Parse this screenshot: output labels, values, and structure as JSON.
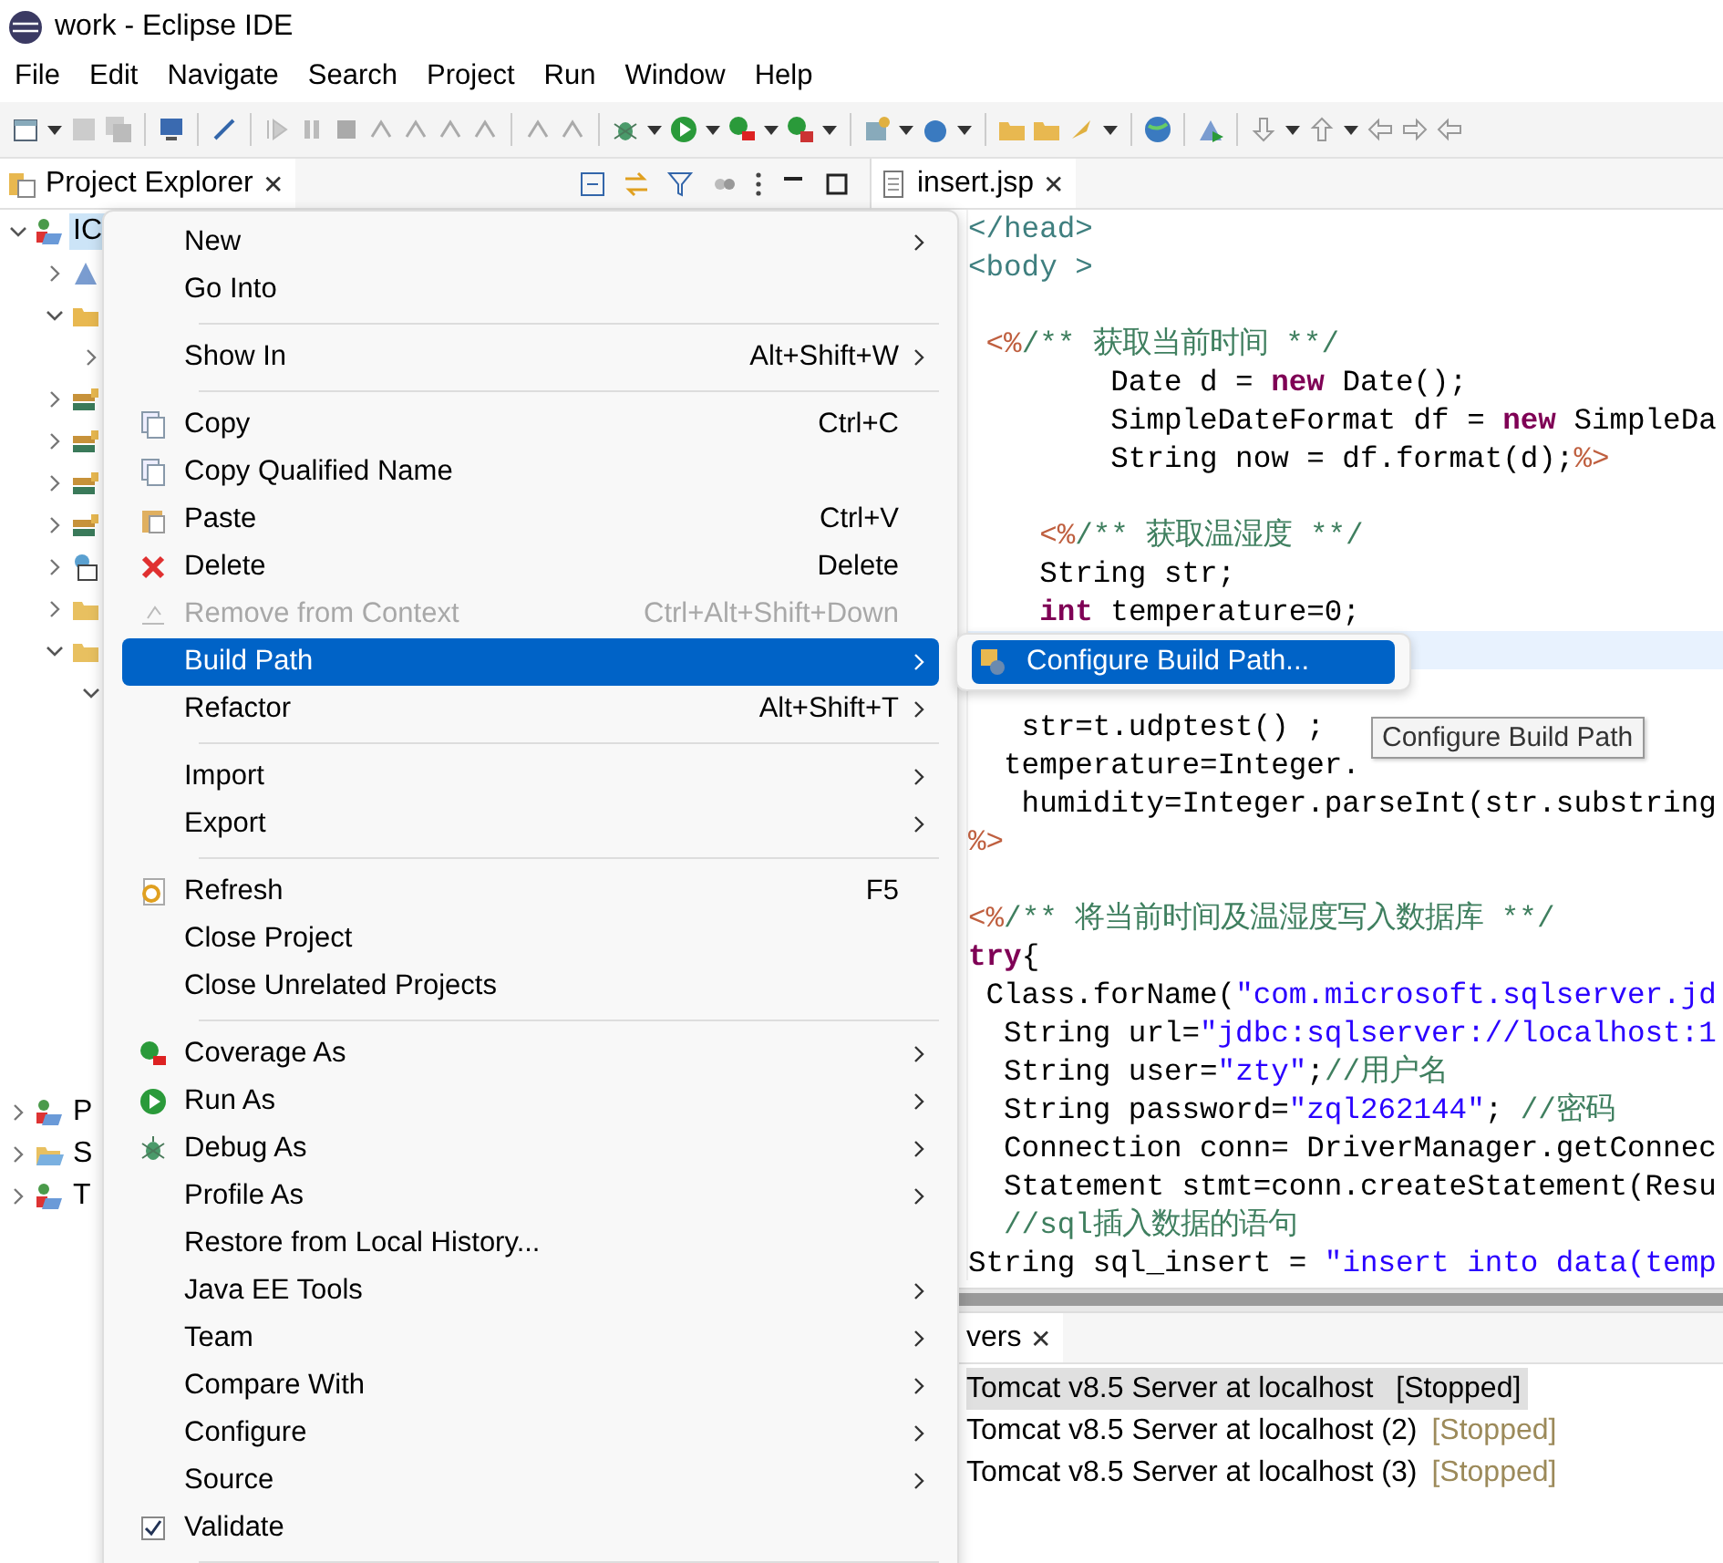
{
  "window": {
    "title": "work - Eclipse IDE"
  },
  "menubar": [
    "File",
    "Edit",
    "Navigate",
    "Search",
    "Project",
    "Run",
    "Window",
    "Help"
  ],
  "project_explorer": {
    "tab": {
      "label": "Project Explorer",
      "close": "✕"
    },
    "tree": [
      {
        "label": "IC",
        "kind": "project",
        "expanded": true,
        "selected": true,
        "children": [
          {
            "kind": "server",
            "expanded": false,
            "selected": false
          },
          {
            "kind": "package",
            "expanded": true,
            "selected": false,
            "children": [
              {
                "expanded": false,
                "selected": false
              }
            ]
          },
          {
            "kind": "library",
            "expanded": false,
            "selected": false
          },
          {
            "kind": "library",
            "expanded": false,
            "selected": false
          },
          {
            "kind": "library",
            "expanded": false,
            "selected": false
          },
          {
            "kind": "library",
            "expanded": false,
            "selected": false
          },
          {
            "kind": "web",
            "expanded": false,
            "selected": false
          },
          {
            "kind": "folder",
            "expanded": false,
            "selected": false
          },
          {
            "kind": "folder",
            "expanded": true,
            "selected": false,
            "children": [
              {
                "expanded": true,
                "selected": false
              }
            ]
          }
        ]
      },
      {
        "label": "P",
        "kind": "project",
        "expanded": false,
        "selected": false
      },
      {
        "label": "S",
        "kind": "openfolder",
        "expanded": false,
        "selected": false
      },
      {
        "label": "T",
        "kind": "project",
        "expanded": false,
        "selected": false
      }
    ]
  },
  "editor": {
    "tab": {
      "label": "insert.jsp",
      "close": "✕"
    },
    "lines": [
      {
        "current": false,
        "segments": [
          {
            "t": "</head>",
            "kind": "tag"
          }
        ]
      },
      {
        "current": false,
        "segments": [
          {
            "t": "<body >",
            "kind": "tag"
          }
        ]
      },
      {
        "current": false
      },
      {
        "current": false,
        "segments": [
          {
            "t": " <%",
            "kind": "jsp"
          },
          {
            "t": "/** 获取当前时间 **/",
            "kind": "comment"
          }
        ]
      },
      {
        "current": false,
        "segments": [
          {
            "t": "        Date d = ",
            "kind": "plain"
          },
          {
            "t": "new",
            "kind": "kw"
          },
          {
            "t": " Date();",
            "kind": "plain"
          }
        ]
      },
      {
        "current": false,
        "segments": [
          {
            "t": "        SimpleDateFormat df = ",
            "kind": "plain"
          },
          {
            "t": "new",
            "kind": "kw"
          },
          {
            "t": " SimpleDa",
            "kind": "plain"
          }
        ]
      },
      {
        "current": false,
        "segments": [
          {
            "t": "        String now = df.format(d);",
            "kind": "plain"
          },
          {
            "t": "%>",
            "kind": "jsp"
          }
        ]
      },
      {
        "current": false
      },
      {
        "current": false,
        "segments": [
          {
            "t": "    <%",
            "kind": "jsp"
          },
          {
            "t": "/** 获取温湿度 **/",
            "kind": "comment"
          }
        ]
      },
      {
        "current": false,
        "segments": [
          {
            "t": "    String str;",
            "kind": "plain"
          }
        ]
      },
      {
        "current": false,
        "segments": [
          {
            "t": "    int",
            "kind": "kw"
          },
          {
            "t": " temperature=0;",
            "kind": "plain"
          }
        ]
      },
      {
        "current": true
      },
      {
        "current": false
      },
      {
        "current": false,
        "segments": [
          {
            "t": "   str=t.udptest() ;",
            "kind": "plain"
          }
        ]
      },
      {
        "current": false,
        "segments": [
          {
            "t": "  temperature=Integer.",
            "kind": "plain"
          }
        ]
      },
      {
        "current": false,
        "segments": [
          {
            "t": "   humidity=Integer.parseInt(str.substring",
            "kind": "plain"
          }
        ]
      },
      {
        "current": false,
        "segments": [
          {
            "t": "%>",
            "kind": "jsp"
          }
        ]
      },
      {
        "current": false
      },
      {
        "current": false,
        "segments": [
          {
            "t": "<%",
            "kind": "jsp"
          },
          {
            "t": "/** 将当前时间及温湿度写入数据库 **/",
            "kind": "comment"
          }
        ]
      },
      {
        "current": false,
        "segments": [
          {
            "t": "try",
            "kind": "kw"
          },
          {
            "t": "{",
            "kind": "plain"
          }
        ]
      },
      {
        "current": false,
        "segments": [
          {
            "t": " Class.forName(",
            "kind": "plain"
          },
          {
            "t": "\"com.microsoft.sqlserver.jd",
            "kind": "str"
          }
        ]
      },
      {
        "current": false,
        "segments": [
          {
            "t": "  String url=",
            "kind": "plain"
          },
          {
            "t": "\"jdbc:sqlserver://localhost:1",
            "kind": "str"
          }
        ]
      },
      {
        "current": false,
        "segments": [
          {
            "t": "  String user=",
            "kind": "plain"
          },
          {
            "t": "\"zty\"",
            "kind": "str"
          },
          {
            "t": ";",
            "kind": "plain"
          },
          {
            "t": "//用户名",
            "kind": "comment"
          }
        ]
      },
      {
        "current": false,
        "segments": [
          {
            "t": "  String password=",
            "kind": "plain"
          },
          {
            "t": "\"zql262144\"",
            "kind": "str"
          },
          {
            "t": "; ",
            "kind": "plain"
          },
          {
            "t": "//密码",
            "kind": "comment"
          }
        ]
      },
      {
        "current": false,
        "segments": [
          {
            "t": "  Connection conn= DriverManager.getConnec",
            "kind": "plain"
          }
        ]
      },
      {
        "current": false,
        "segments": [
          {
            "t": "  Statement stmt=conn.createStatement(Resu",
            "kind": "plain"
          }
        ]
      },
      {
        "current": false,
        "segments": [
          {
            "t": "  //sql插入数据的语句",
            "kind": "comment"
          }
        ]
      },
      {
        "current": false,
        "segments": [
          {
            "t": "String sql_insert = ",
            "kind": "plain"
          },
          {
            "t": "\"insert into data(temp",
            "kind": "str"
          }
        ]
      }
    ]
  },
  "servers": {
    "tab": {
      "label": "vers",
      "close": "✕"
    },
    "rows": [
      {
        "name": "Tomcat v8.5 Server at localhost ",
        "status": "[Stopped]",
        "selected": true
      },
      {
        "name": "Tomcat v8.5 Server at localhost (2)",
        "status": "[Stopped]",
        "selected": false
      },
      {
        "name": "Tomcat v8.5 Server at localhost (3)",
        "status": "[Stopped]",
        "selected": false
      }
    ]
  },
  "context_menu": {
    "items": [
      {
        "kind": "plain",
        "label": "New",
        "submenu": true,
        "disabled": false,
        "selected": false
      },
      {
        "kind": "plain",
        "label": "Go Into",
        "submenu": false,
        "disabled": false,
        "selected": false
      },
      {
        "kind": "separator"
      },
      {
        "kind": "plain",
        "label": "Show In",
        "shortcut": "Alt+Shift+W",
        "submenu": true,
        "disabled": false,
        "selected": false
      },
      {
        "kind": "separator"
      },
      {
        "kind": "copy",
        "label": "Copy",
        "shortcut": "Ctrl+C",
        "submenu": false,
        "disabled": false,
        "selected": false
      },
      {
        "kind": "copy",
        "label": "Copy Qualified Name",
        "submenu": false,
        "disabled": false,
        "selected": false
      },
      {
        "kind": "paste",
        "label": "Paste",
        "shortcut": "Ctrl+V",
        "submenu": false,
        "disabled": false,
        "selected": false
      },
      {
        "kind": "delete",
        "label": "Delete",
        "shortcut": "Delete",
        "submenu": false,
        "disabled": false,
        "selected": false
      },
      {
        "kind": "remove",
        "label": "Remove from Context",
        "shortcut": "Ctrl+Alt+Shift+Down",
        "submenu": false,
        "disabled": true,
        "selected": false
      },
      {
        "kind": "plain",
        "label": "Build Path",
        "submenu": true,
        "disabled": false,
        "selected": true
      },
      {
        "kind": "plain",
        "label": "Refactor",
        "shortcut": "Alt+Shift+T",
        "submenu": true,
        "disabled": false,
        "selected": false
      },
      {
        "kind": "separator"
      },
      {
        "kind": "plain",
        "label": "Import",
        "submenu": true,
        "disabled": false,
        "selected": false
      },
      {
        "kind": "plain",
        "label": "Export",
        "submenu": true,
        "disabled": false,
        "selected": false
      },
      {
        "kind": "separator"
      },
      {
        "kind": "refresh",
        "label": "Refresh",
        "shortcut": "F5",
        "submenu": false,
        "disabled": false,
        "selected": false
      },
      {
        "kind": "plain",
        "label": "Close Project",
        "submenu": false,
        "disabled": false,
        "selected": false
      },
      {
        "kind": "plain",
        "label": "Close Unrelated Projects",
        "submenu": false,
        "disabled": false,
        "selected": false
      },
      {
        "kind": "separator"
      },
      {
        "kind": "coverage",
        "label": "Coverage As",
        "submenu": true,
        "disabled": false,
        "selected": false
      },
      {
        "kind": "run",
        "label": "Run As",
        "submenu": true,
        "disabled": false,
        "selected": false
      },
      {
        "kind": "debug",
        "label": "Debug As",
        "submenu": true,
        "disabled": false,
        "selected": false
      },
      {
        "kind": "plain",
        "label": "Profile As",
        "submenu": true,
        "disabled": false,
        "selected": false
      },
      {
        "kind": "plain",
        "label": "Restore from Local History...",
        "submenu": false,
        "disabled": false,
        "selected": false
      },
      {
        "kind": "plain",
        "label": "Java EE Tools",
        "submenu": true,
        "disabled": false,
        "selected": false
      },
      {
        "kind": "plain",
        "label": "Team",
        "submenu": true,
        "disabled": false,
        "selected": false
      },
      {
        "kind": "plain",
        "label": "Compare With",
        "submenu": true,
        "disabled": false,
        "selected": false
      },
      {
        "kind": "plain",
        "label": "Configure",
        "submenu": true,
        "disabled": false,
        "selected": false
      },
      {
        "kind": "plain",
        "label": "Source",
        "submenu": true,
        "disabled": false,
        "selected": false
      },
      {
        "kind": "check",
        "label": "Validate",
        "checked": true,
        "submenu": false,
        "disabled": false,
        "selected": false
      },
      {
        "kind": "separator"
      }
    ]
  },
  "submenu": {
    "items": [
      {
        "label": "Configure Build Path...",
        "selected": true
      }
    ]
  },
  "tooltip": {
    "text": "Configure Build Path"
  }
}
